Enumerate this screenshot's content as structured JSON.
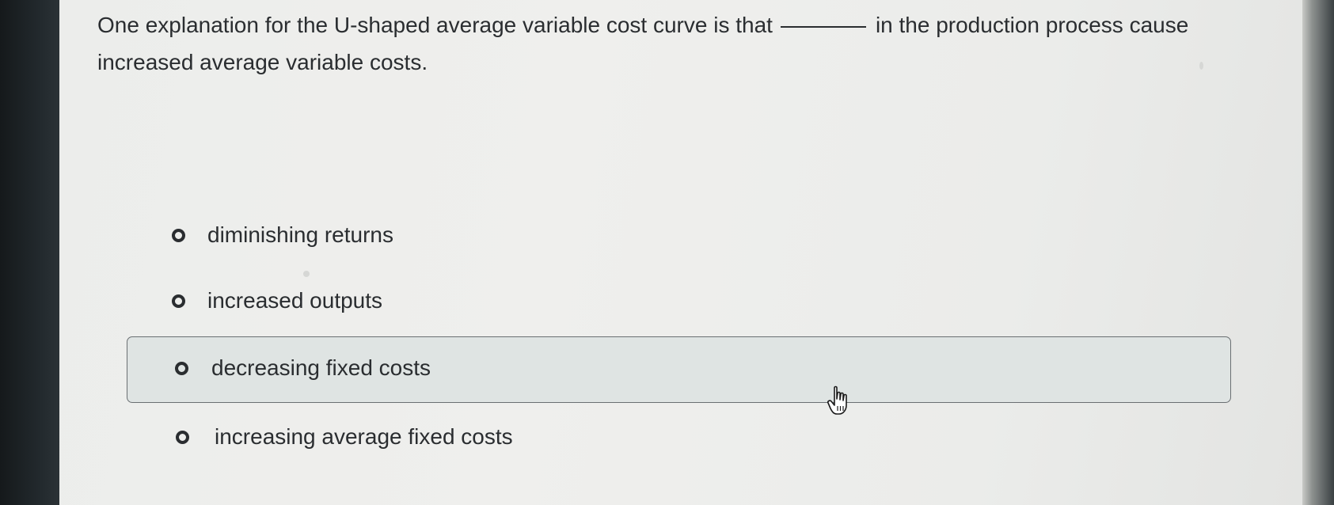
{
  "question": {
    "part1": "One explanation for the U-shaped average variable cost curve is that",
    "part2": "in the production process cause increased average variable costs."
  },
  "options": [
    {
      "label": "diminishing returns"
    },
    {
      "label": "increased outputs"
    },
    {
      "label": "decreasing fixed costs"
    },
    {
      "label": "increasing average fixed costs"
    }
  ],
  "colors": {
    "text": "#2a2d30",
    "hover_background": "#dfe4e3",
    "hover_border": "#6a6f72"
  },
  "cursor_icon": "pointer-hand-icon"
}
